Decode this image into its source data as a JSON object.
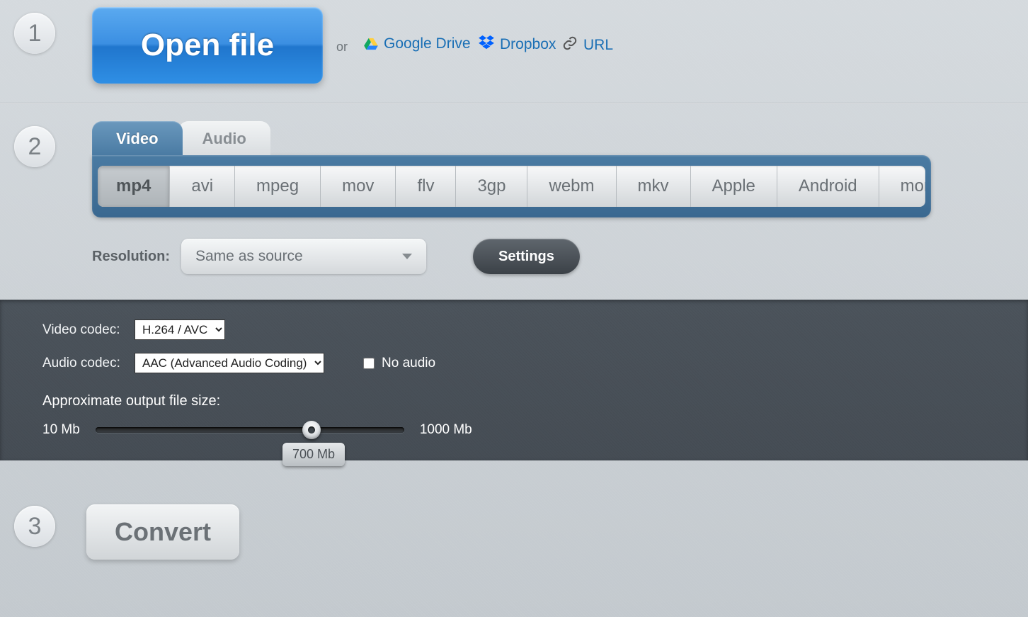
{
  "steps": {
    "s1": "1",
    "s2": "2",
    "s3": "3"
  },
  "open": {
    "button": "Open file",
    "or": "or",
    "gdrive": "Google Drive",
    "dropbox": "Dropbox",
    "url": "URL"
  },
  "tabs": {
    "video": "Video",
    "audio": "Audio"
  },
  "formats": {
    "mp4": "mp4",
    "avi": "avi",
    "mpeg": "mpeg",
    "mov": "mov",
    "flv": "flv",
    "3gp": "3gp",
    "webm": "webm",
    "mkv": "mkv",
    "apple": "Apple",
    "android": "Android",
    "more": "more"
  },
  "resolution": {
    "label": "Resolution:",
    "value": "Same as source"
  },
  "settings_btn": "Settings",
  "codec": {
    "video_label": "Video codec:",
    "video_value": "H.264 / AVC",
    "audio_label": "Audio codec:",
    "audio_value": "AAC (Advanced Audio Coding)",
    "no_audio": "No audio"
  },
  "size": {
    "label": "Approximate output file size:",
    "min": "10 Mb",
    "max": "1000 Mb",
    "current": "700 Mb"
  },
  "convert": "Convert"
}
